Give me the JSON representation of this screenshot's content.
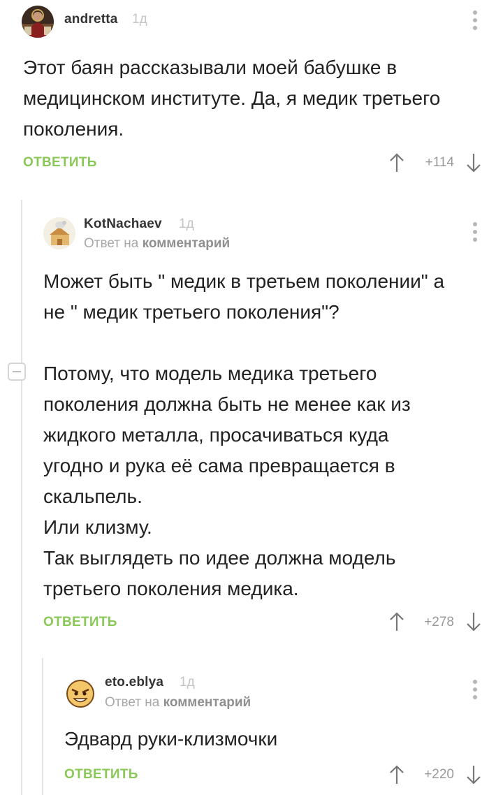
{
  "comments": [
    {
      "username": "andretta",
      "time": "1д",
      "text": [
        "Этот баян рассказывали моей бабушке в",
        "медицинском институте. Да, я медик третьего",
        "поколения."
      ],
      "reply_label": "ОТВЕТИТЬ",
      "rating": "+114"
    },
    {
      "username": "KotNachaev",
      "time": "1д",
      "reply_prefix": "Ответ на",
      "reply_target": "комментарий",
      "text": [
        "Может быть \" медик в третьем поколении\" а",
        "не \" медик третьего поколения\"?",
        "",
        "Потому, что модель медика третьего",
        "поколения должна быть не менее как из",
        "жидкого металла, просачиваться куда",
        "угодно и рука её сама превращается в",
        "скальпель.",
        "Или клизму.",
        "Так выглядеть по идее должна модель",
        "третьего поколения медика."
      ],
      "reply_label": "ОТВЕТИТЬ",
      "rating": "+278"
    },
    {
      "username": "eto.eblya",
      "time": "1д",
      "reply_prefix": "Ответ на",
      "reply_target": "комментарий",
      "text": [
        "Эдвард руки-клизмочки"
      ],
      "reply_label": "ОТВЕТИТЬ",
      "rating": "+220"
    }
  ],
  "icons": {
    "upvote": "arrow-up-icon",
    "downvote": "arrow-down-icon",
    "more": "more-vertical-icon",
    "collapse": "minus-icon"
  },
  "colors": {
    "reply": "#8ac858",
    "thread_line": "#e3e3e3",
    "muted": "#a8a8a8"
  }
}
